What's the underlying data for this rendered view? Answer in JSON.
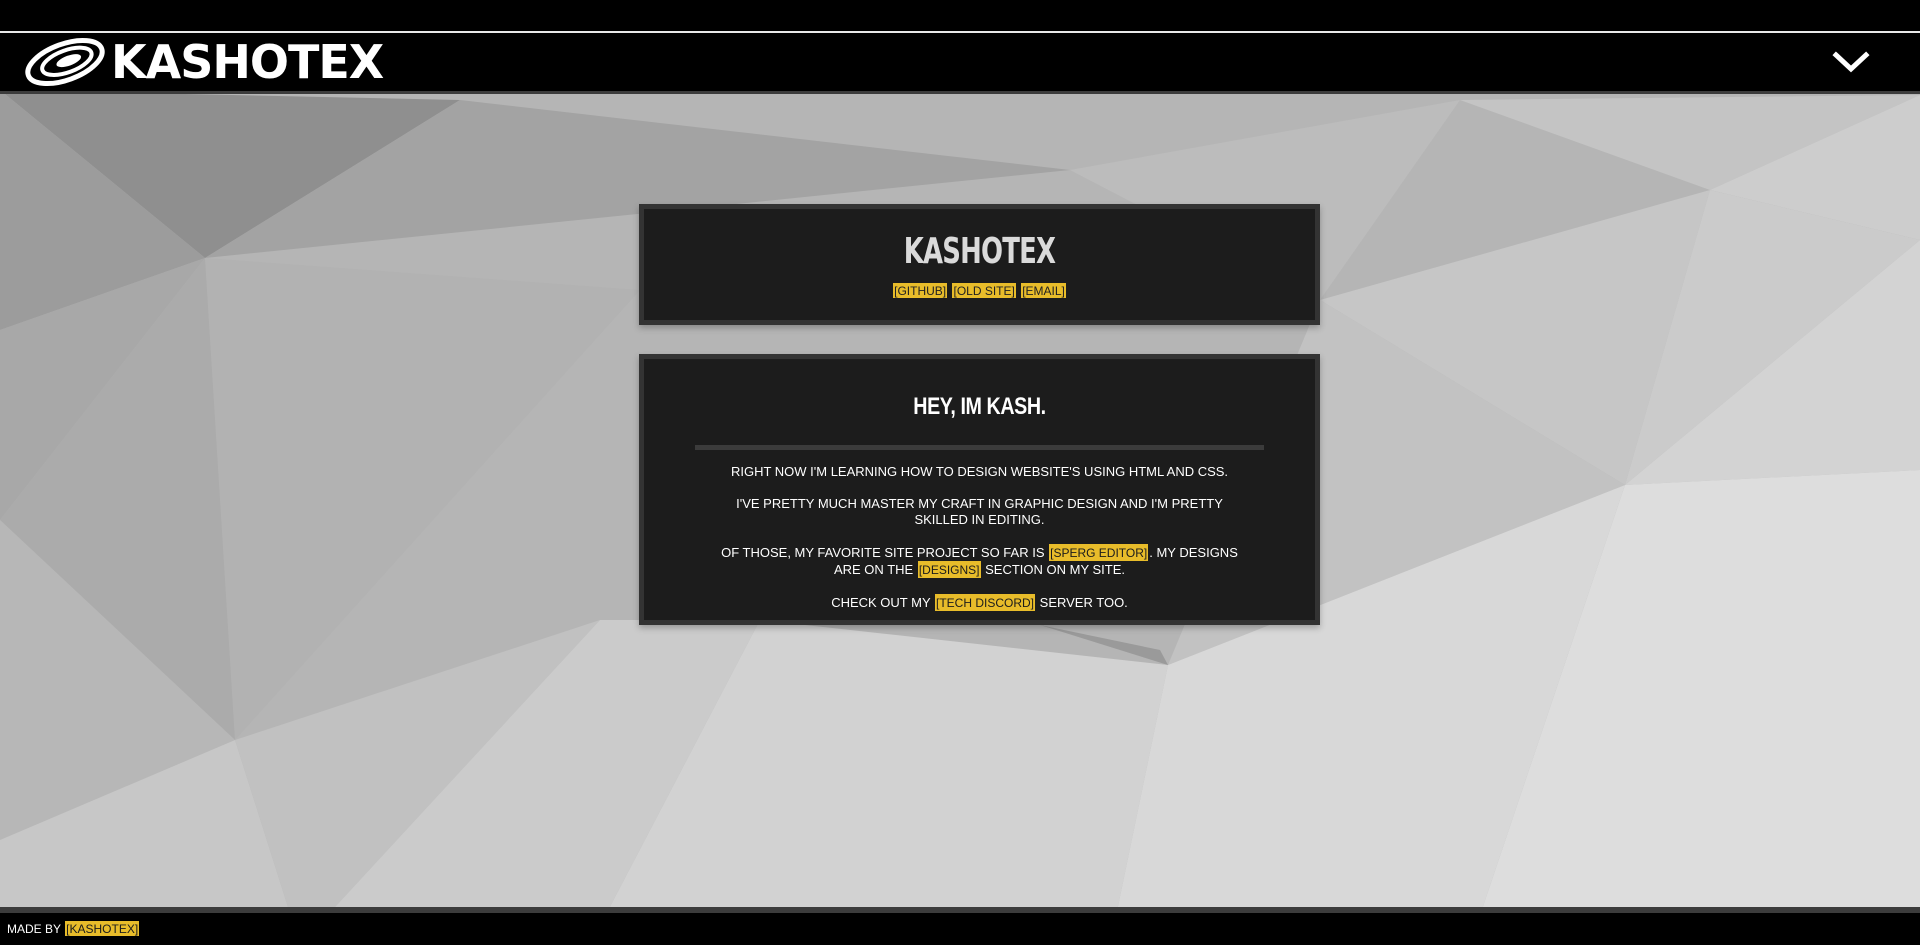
{
  "header": {
    "logo_text": "KASHOTEX",
    "logo_icon": "galaxy-icon",
    "menu_icon": "chevron-down-icon"
  },
  "intro_card": {
    "title": "KASHOTEX",
    "links": [
      "[GITHUB]",
      "[OLD SITE]",
      "[EMAIL]"
    ]
  },
  "about_card": {
    "heading": "HEY, IM KASH.",
    "p1": "RIGHT NOW I'M LEARNING HOW TO DESIGN WEBSITE'S USING HTML AND CSS.",
    "p2": "I'VE PRETTY MUCH MASTER MY CRAFT IN GRAPHIC DESIGN AND I'M PRETTY SKILLED IN EDITING.",
    "p3_before": "OF THOSE, MY FAVORITE SITE PROJECT SO FAR IS ",
    "p3_link1": "[SPERG EDITOR]",
    "p3_middle": ". MY DESIGNS ARE ON THE ",
    "p3_link2": "[DESIGNS]",
    "p3_after": " SECTION ON MY SITE.",
    "p4_before": "CHECK OUT MY ",
    "p4_link": "[TECH DISCORD]",
    "p4_after": " SERVER TOO."
  },
  "footer": {
    "made_by": "MADE BY ",
    "author_link": "[KASHOTEX]"
  },
  "colors": {
    "accent": "#e8bc2a",
    "card_bg": "#1c1c1c",
    "card_border": "#333333",
    "bar_bg": "#000000"
  }
}
